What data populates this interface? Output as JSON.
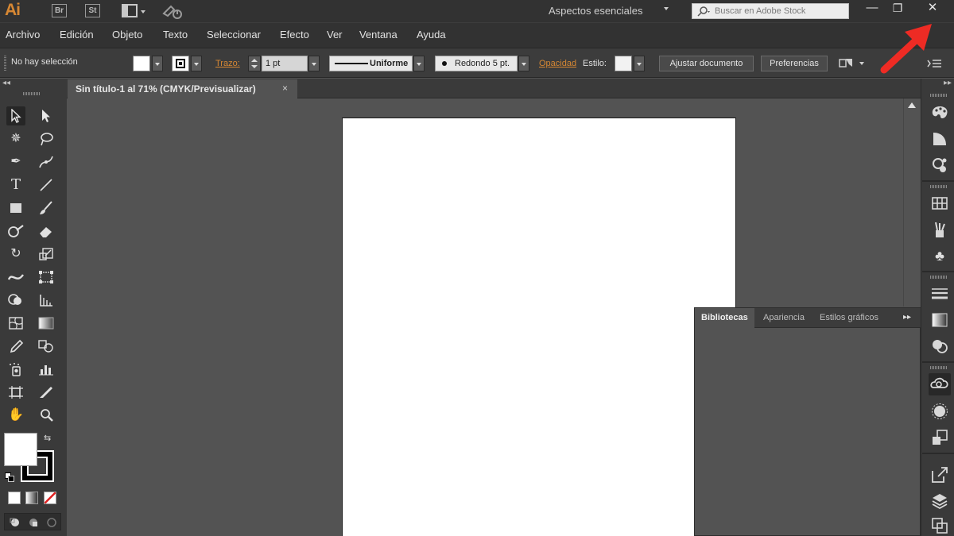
{
  "title_bar": {
    "app_logo": "Ai",
    "bridge_label": "Br",
    "stock_label": "St",
    "workspace": "Aspectos esenciales",
    "search_placeholder": "Buscar en Adobe Stock",
    "minimize_glyph": "—",
    "restore_glyph": "❐",
    "close_glyph": "✕"
  },
  "menu": [
    {
      "label": "Archivo"
    },
    {
      "label": "Edición"
    },
    {
      "label": "Objeto"
    },
    {
      "label": "Texto"
    },
    {
      "label": "Seleccionar"
    },
    {
      "label": "Efecto"
    },
    {
      "label": "Ver"
    },
    {
      "label": "Ventana"
    },
    {
      "label": "Ayuda"
    }
  ],
  "control_bar": {
    "selection_status": "No hay selección",
    "stroke_label": "Trazo:",
    "stroke_weight": "1 pt",
    "stroke_profile": "Uniforme",
    "brush": "Redondo 5 pt.",
    "opacity_label": "Opacidad",
    "style_label": "Estilo:",
    "document_setup_button": "Ajustar documento",
    "preferences_button": "Preferencias"
  },
  "document_tab": {
    "title": "Sin título-1 al 71% (CMYK/Previsualizar)",
    "close_glyph": "×"
  },
  "libraries_panel": {
    "tabs": [
      {
        "label": "Bibliotecas",
        "active": true
      },
      {
        "label": "Apariencia",
        "active": false
      },
      {
        "label": "Estilos gráficos",
        "active": false
      }
    ],
    "menu_glyph": "▸▸"
  },
  "colors": {
    "app_accent": "#d68733",
    "chrome_dark": "#323232",
    "panel": "#3c3c3c",
    "canvas_bg": "#535353",
    "artboard": "#ffffff",
    "annotation_arrow": "#ee2b24"
  },
  "icons": {
    "tools": [
      "selection-icon",
      "direct-selection-icon",
      "magic-wand-icon",
      "lasso-icon",
      "pen-icon",
      "curvature-icon",
      "type-icon",
      "line-segment-icon",
      "rectangle-icon",
      "paintbrush-icon",
      "shaper-icon",
      "eraser-icon",
      "rotate-icon",
      "scale-icon",
      "width-icon",
      "free-transform-icon",
      "shape-builder-icon",
      "perspective-grid-icon",
      "mesh-icon",
      "gradient-icon",
      "eyedropper-icon",
      "blend-icon",
      "symbol-sprayer-icon",
      "column-graph-icon",
      "artboard-icon",
      "slice-icon",
      "hand-icon",
      "zoom-icon"
    ],
    "dock": [
      "color-icon",
      "color-guide-icon",
      "color-themes-icon",
      "swatches-icon",
      "brushes-icon",
      "symbols-icon",
      "stroke-icon",
      "gradient-panel-icon",
      "transparency-icon",
      "libraries-icon",
      "appearance-icon",
      "graphic-styles-icon",
      "export-icon",
      "layers-icon",
      "artboards-icon"
    ]
  }
}
